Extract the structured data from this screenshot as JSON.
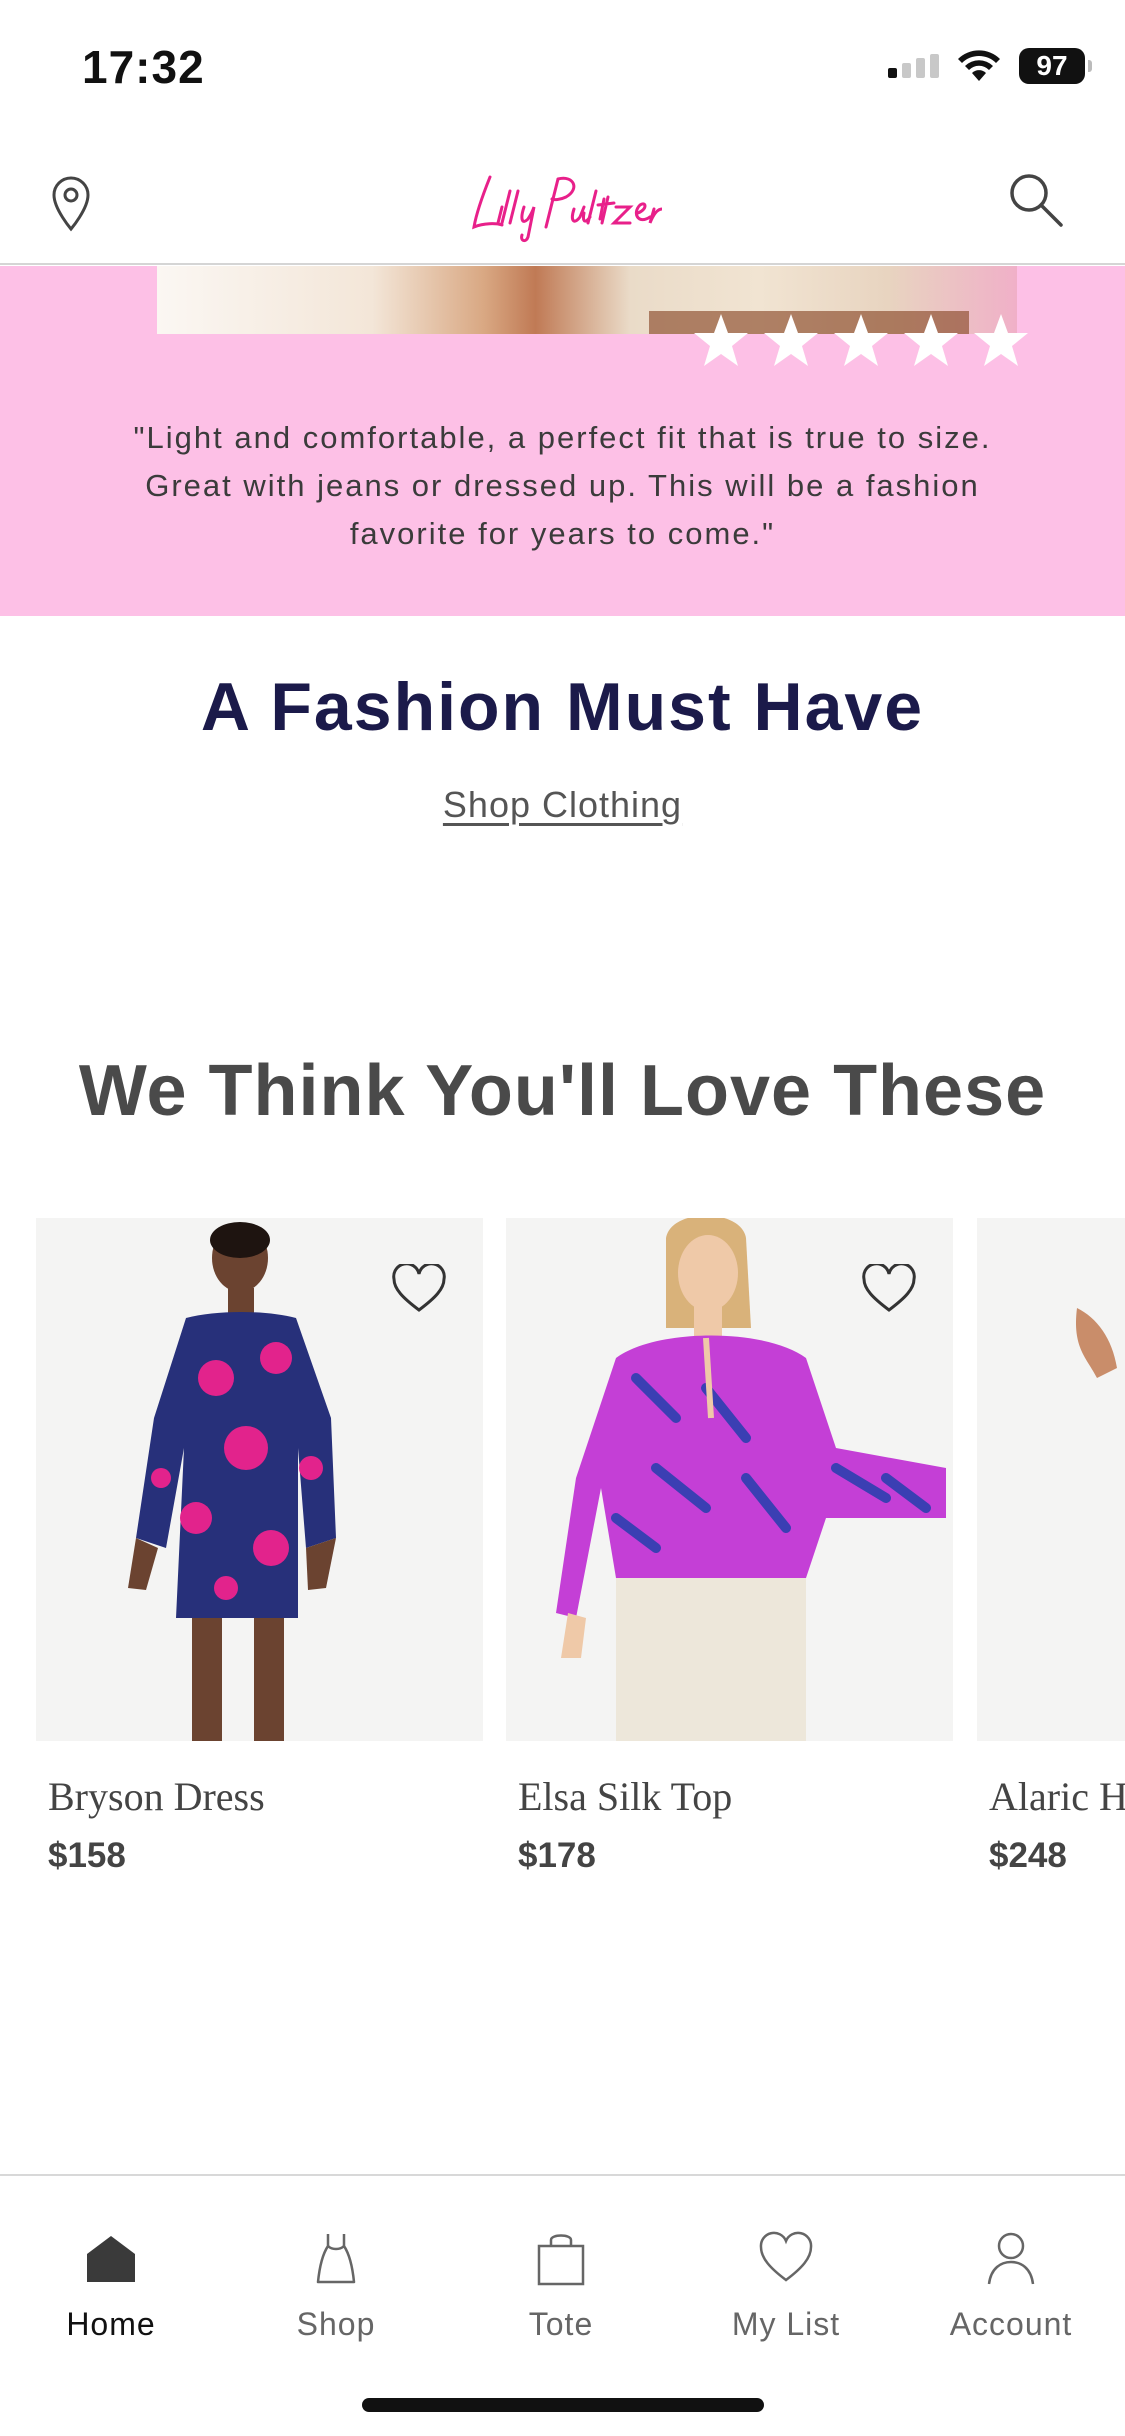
{
  "status_bar": {
    "time": "17:32",
    "battery": "97"
  },
  "header": {
    "logo_text": "Lilly Pulitzer"
  },
  "review": {
    "stars": 5,
    "quote": "\"Light and comfortable, a perfect fit that is true to size. Great with jeans or dressed up. This will be a fashion favorite for years to come.\""
  },
  "fashion": {
    "title": "A Fashion Must Have",
    "link": "Shop Clothing"
  },
  "recommendations": {
    "title": "We Think You'll Love These",
    "products": [
      {
        "name": "Bryson Dress",
        "price": "$158"
      },
      {
        "name": "Elsa Silk Top",
        "price": "$178"
      },
      {
        "name": "Alaric H",
        "price": "$248"
      }
    ]
  },
  "tab_bar": {
    "items": [
      {
        "label": "Home",
        "icon": "home-icon",
        "active": true
      },
      {
        "label": "Shop",
        "icon": "dress-icon",
        "active": false
      },
      {
        "label": "Tote",
        "icon": "bag-icon",
        "active": false
      },
      {
        "label": "My List",
        "icon": "heart-icon",
        "active": false
      },
      {
        "label": "Account",
        "icon": "person-icon",
        "active": false
      }
    ]
  },
  "colors": {
    "accent_pink": "#e8208a",
    "banner_pink": "#fdc0e6",
    "navy": "#1b1a4a"
  }
}
